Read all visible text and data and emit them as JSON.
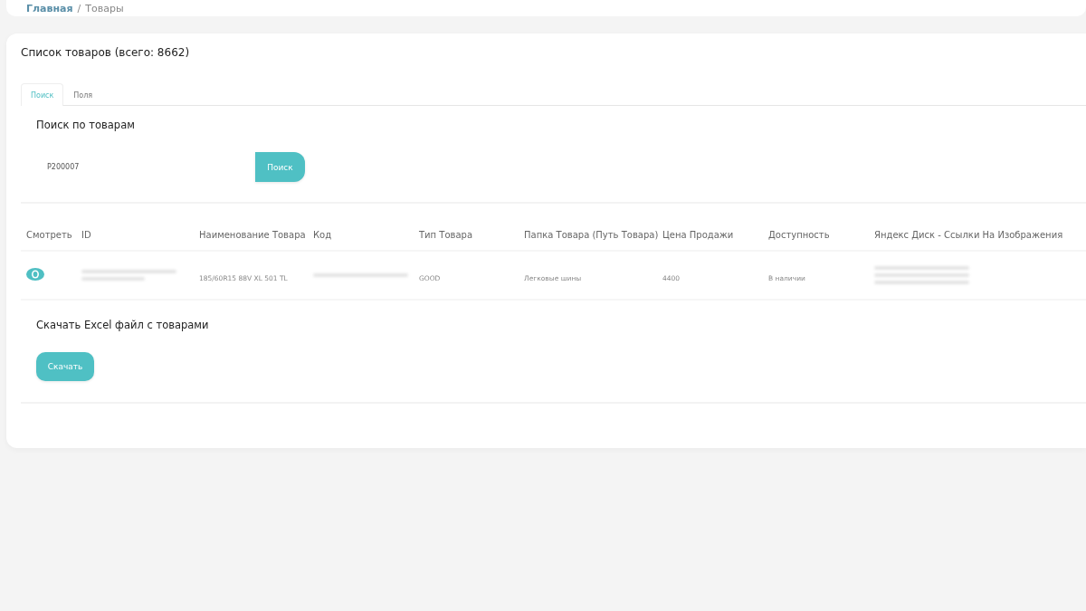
{
  "breadcrumb": [
    {
      "label": "Главная",
      "kind": "link"
    },
    {
      "label": "/",
      "kind": "separator"
    },
    {
      "label": "Товары",
      "kind": "current"
    }
  ],
  "card": {
    "title": "Список товаров (всего: 8662)"
  },
  "tabs": [
    {
      "label": "Поиск",
      "selected": true
    },
    {
      "label": "Поля",
      "selected": false
    }
  ],
  "search": {
    "title": "Поиск по товарам",
    "value": "P200007",
    "button": "Поиск"
  },
  "table": {
    "columns": [
      "Смотреть",
      "ID",
      "Наименование Товара",
      "Код",
      "Тип Товара",
      "Папка Товара (Путь Товара)",
      "Цена Продажи",
      "Доступность",
      "Яндекс Диск - Ссылки На Изображения"
    ],
    "rows": [
      {
        "cells": [
          {
            "kind": "view"
          },
          {
            "kind": "redacted",
            "lines": [
              {
                "long": true
              },
              {
                "long": false
              }
            ]
          },
          {
            "kind": "text",
            "text": "185/60R15 88V XL 501 TL"
          },
          {
            "kind": "redacted",
            "lines": [
              {
                "long": true
              }
            ]
          },
          {
            "kind": "text",
            "text": "GOOD"
          },
          {
            "kind": "text",
            "text": "Легковые шины"
          },
          {
            "kind": "text",
            "text": "4400"
          },
          {
            "kind": "text",
            "text": "В наличии"
          },
          {
            "kind": "redacted",
            "lines": [
              {
                "long": true
              },
              {
                "long": true
              },
              {
                "long": true
              }
            ]
          }
        ]
      }
    ]
  },
  "download": {
    "title": "Скачать Excel файл с товарами",
    "button": "Скачать"
  }
}
